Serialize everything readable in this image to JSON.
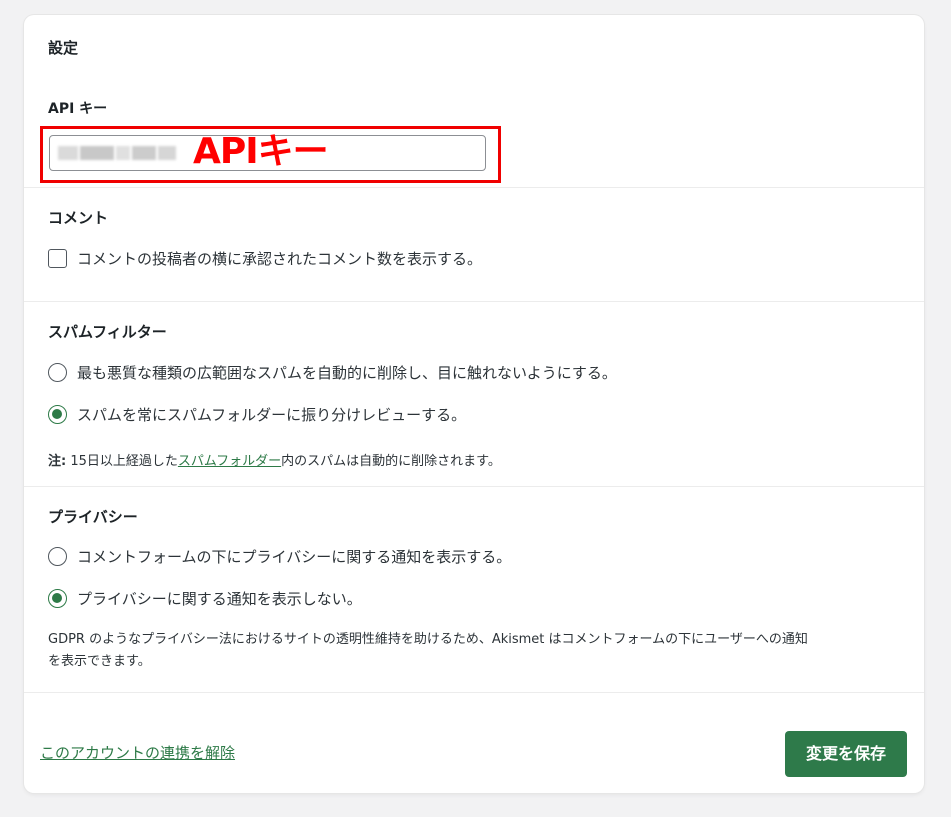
{
  "settings": {
    "title": "設定",
    "api": {
      "label": "API キー",
      "annotation": "APIキー"
    },
    "comments": {
      "heading": "コメント",
      "checkbox_label": "コメントの投稿者の横に承認されたコメント数を表示する。",
      "checked": false
    },
    "spam": {
      "heading": "スパムフィルター",
      "options": [
        {
          "label": "最も悪質な種類の広範囲なスパムを自動的に削除し、目に触れないようにする。",
          "checked": false
        },
        {
          "label": "スパムを常にスパムフォルダーに振り分けレビューする。",
          "checked": true
        }
      ],
      "note_prefix": "注:",
      "note_before_link": " 15日以上経過した",
      "note_link": "スパムフォルダー",
      "note_after_link": "内のスパムは自動的に削除されます。"
    },
    "privacy": {
      "heading": "プライバシー",
      "options": [
        {
          "label": "コメントフォームの下にプライバシーに関する通知を表示する。",
          "checked": false
        },
        {
          "label": "プライバシーに関する通知を表示しない。",
          "checked": true
        }
      ],
      "description_line1": "GDPR のようなプライバシー法におけるサイトの透明性維持を助けるため、Akismet はコメントフォームの下にユーザーへの通知",
      "description_line2": "を表示できます。"
    },
    "footer": {
      "disconnect_label": "このアカウントの連携を解除",
      "save_label": "変更を保存"
    }
  },
  "colors": {
    "accent": "#2e7a4a",
    "highlight": "#ff0000",
    "background": "#f2f2f3"
  }
}
